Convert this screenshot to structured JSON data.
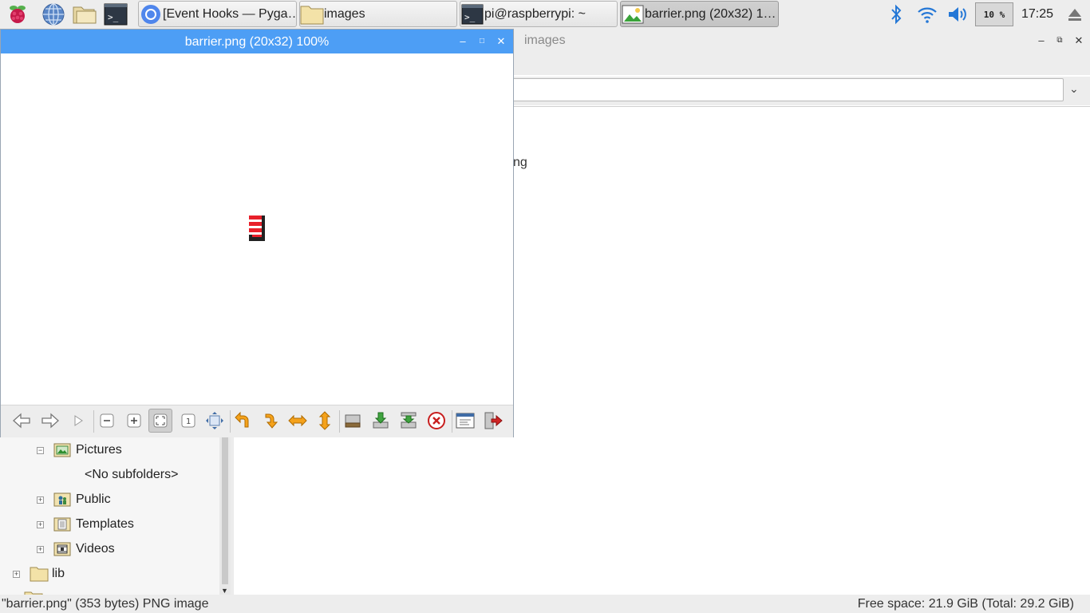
{
  "taskbar": {
    "launchers": [
      "raspberry-menu-icon",
      "web-browser-icon",
      "file-manager-icon",
      "terminal-icon"
    ],
    "tasks": [
      {
        "label": "[Event Hooks — Pyga…",
        "icon": "chromium-icon",
        "active": false
      },
      {
        "label": "images",
        "icon": "folder-icon",
        "active": false
      },
      {
        "label": "pi@raspberrypi: ~",
        "icon": "terminal-icon",
        "active": false
      },
      {
        "label": "barrier.png (20x32) 1…",
        "icon": "image-viewer-icon",
        "active": true
      }
    ],
    "tray": {
      "cpu_label": "10 %",
      "clock": "17:25"
    }
  },
  "viewer": {
    "title": "barrier.png (20x32) 100%",
    "toolbar": [
      "previous-icon",
      "next-icon",
      "slideshow-icon",
      "zoom-out-icon",
      "zoom-in-icon",
      "zoom-fit-icon",
      "original-size-icon",
      "fullscreen-icon",
      "rotate-left-icon",
      "rotate-right-icon",
      "flip-horizontal-icon",
      "flip-vertical-icon",
      "open-file-icon",
      "save-file-icon",
      "save-as-icon",
      "delete-icon",
      "preferences-icon",
      "exit-icon"
    ]
  },
  "file_manager": {
    "title": "images",
    "file_fragment": "ng",
    "tree": [
      {
        "label": "Pictures",
        "expander": "−",
        "icon": "pictures-folder-icon"
      },
      {
        "label": "<No subfolders>"
      },
      {
        "label": "Public",
        "expander": "+",
        "icon": "public-folder-icon"
      },
      {
        "label": "Templates",
        "expander": "+",
        "icon": "templates-folder-icon"
      },
      {
        "label": "Videos",
        "expander": "+",
        "icon": "videos-folder-icon"
      },
      {
        "label": "lib",
        "expander": "+",
        "icon": "folder-icon"
      }
    ],
    "status_left": "\"barrier.png\" (353 bytes) PNG image",
    "status_right": "Free space: 21.9 GiB (Total: 29.2 GiB)"
  },
  "colors": {
    "title_active": "#4d9ef5",
    "taskbar": "#ededed",
    "barrier_red": "#e8202a"
  }
}
